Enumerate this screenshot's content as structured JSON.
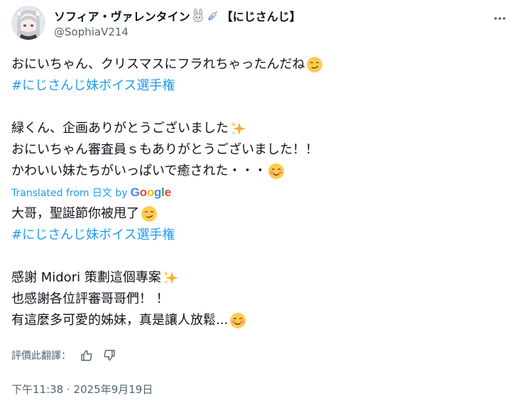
{
  "author": {
    "display_name": "ソフィア・ヴァレンタイン",
    "name_suffix": "【にじさんじ】",
    "handle": "@SophiaV214",
    "name_icons": [
      "rabbit-icon",
      "syringe-icon"
    ]
  },
  "original_text": {
    "line1": "おにいちゃん、クリスマスにフラれちゃったんだね",
    "hashtag1": "#にじさんじ妹ボイス選手権",
    "line3": "緑くん、企画ありがとうございました",
    "line4": "おにいちゃん審査員ｓもありがとうございました！！",
    "line5": "かわいい妹たちがいっぱいで癒された・・・"
  },
  "translation": {
    "label": "Translated from 日文 by",
    "provider": "Google",
    "line1": "大哥，聖誕節你被甩了",
    "hashtag1": "#にじさんじ妹ボイス選手権",
    "line3": "感謝 Midori 策劃這個專案",
    "line4": "也感謝各位評審哥哥們！ ！",
    "line5": "有這麼多可愛的姊妹，真是讓人放鬆..."
  },
  "rate_translation": {
    "label": "評價此翻譯："
  },
  "timestamp": "下午11:38 · 2025年9月19日",
  "colors": {
    "link": "#1d9bf0",
    "secondary_text": "#536471",
    "primary_text": "#0f1419"
  }
}
